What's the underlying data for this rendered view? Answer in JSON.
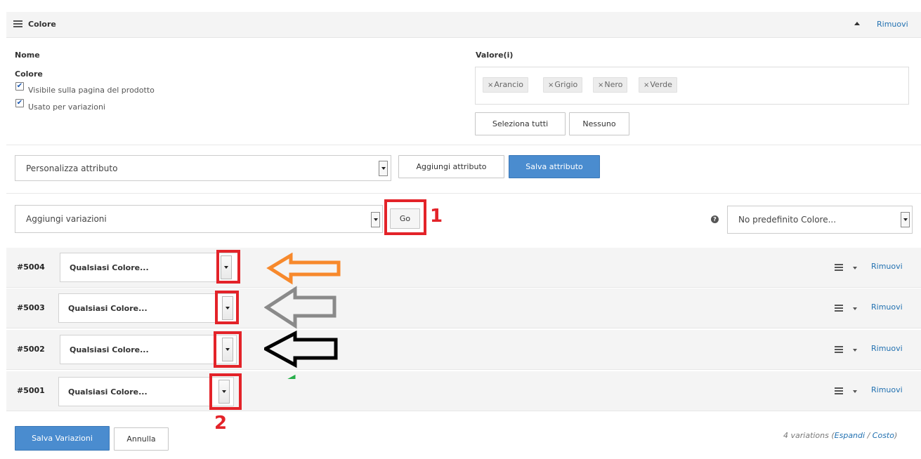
{
  "attribute": {
    "title": "Colore",
    "remove_label": "Rimuovi",
    "name_header": "Nome",
    "values_header": "Valore(i)",
    "name": "Colore",
    "visible_label": "Visibile sulla pagina del prodotto",
    "variations_label": "Usato per variazioni",
    "visible_checked": true,
    "variations_checked": true,
    "tags": [
      "Arancio",
      "Grigio",
      "Nero",
      "Verde"
    ],
    "select_all_label": "Seleziona tutti",
    "none_label": "Nessuno"
  },
  "attribute_toolbar": {
    "select_value": "Personalizza attributo",
    "add_button": "Aggiungi attributo",
    "save_button": "Salva attributo"
  },
  "variations_toolbar": {
    "select_value": "Aggiungi variazioni",
    "go_button": "Go",
    "default_select_value": "No predefinito Colore..."
  },
  "variations": [
    {
      "id": "#5004",
      "value": "Qualsiasi Colore...",
      "remove": "Rimuovi"
    },
    {
      "id": "#5003",
      "value": "Qualsiasi Colore...",
      "remove": "Rimuovi"
    },
    {
      "id": "#5002",
      "value": "Qualsiasi Colore...",
      "remove": "Rimuovi"
    },
    {
      "id": "#5001",
      "value": "Qualsiasi Colore...",
      "remove": "Rimuovi"
    }
  ],
  "annotations": {
    "label_1": "1",
    "label_2": "2",
    "arrow_colors": [
      "#f7892c",
      "#8a8a8a",
      "#000000",
      "#27ae4a"
    ],
    "highlight_color": "#e32329"
  },
  "footer": {
    "save_button": "Salva Variazioni",
    "cancel_button": "Annulla",
    "count_text": "4 variations (",
    "expand_link": "Espandi",
    "slash": " / ",
    "cost_link": "Costo",
    "close_paren": ")"
  },
  "colors": {
    "accent": "#4a8ccf",
    "link": "#2271b1",
    "panel_bg": "#f4f4f4"
  }
}
